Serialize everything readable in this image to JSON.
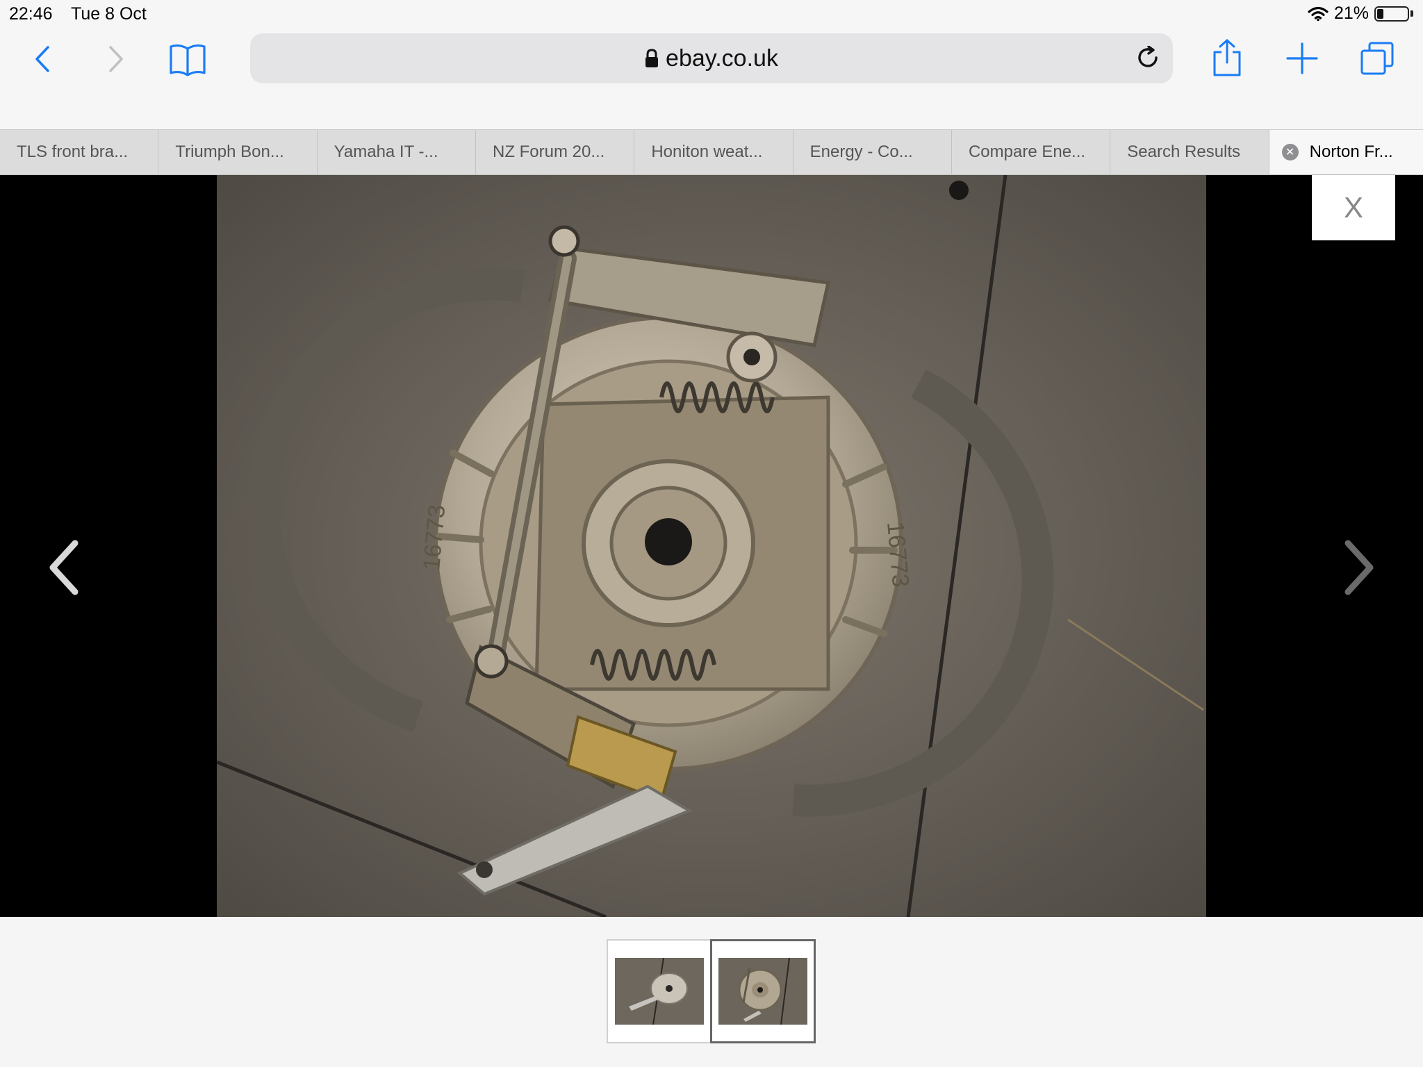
{
  "status": {
    "time": "22:46",
    "date": "Tue 8 Oct",
    "battery": "21%",
    "battery_level": 0.21
  },
  "browser": {
    "url": "ebay.co.uk"
  },
  "tabs": [
    {
      "label": "TLS front bra..."
    },
    {
      "label": "Triumph Bon..."
    },
    {
      "label": "Yamaha IT -..."
    },
    {
      "label": "NZ Forum 20..."
    },
    {
      "label": "Honiton weat..."
    },
    {
      "label": "Energy - Co..."
    },
    {
      "label": "Compare Ene..."
    },
    {
      "label": "Search Results"
    },
    {
      "label": "Norton Fr..."
    }
  ],
  "viewer": {
    "close_label": "X",
    "part_stamp_left": "16773",
    "part_stamp_right": "16773"
  },
  "colors": {
    "ios_blue": "#1a7cf5",
    "backdrop": "#000000"
  }
}
